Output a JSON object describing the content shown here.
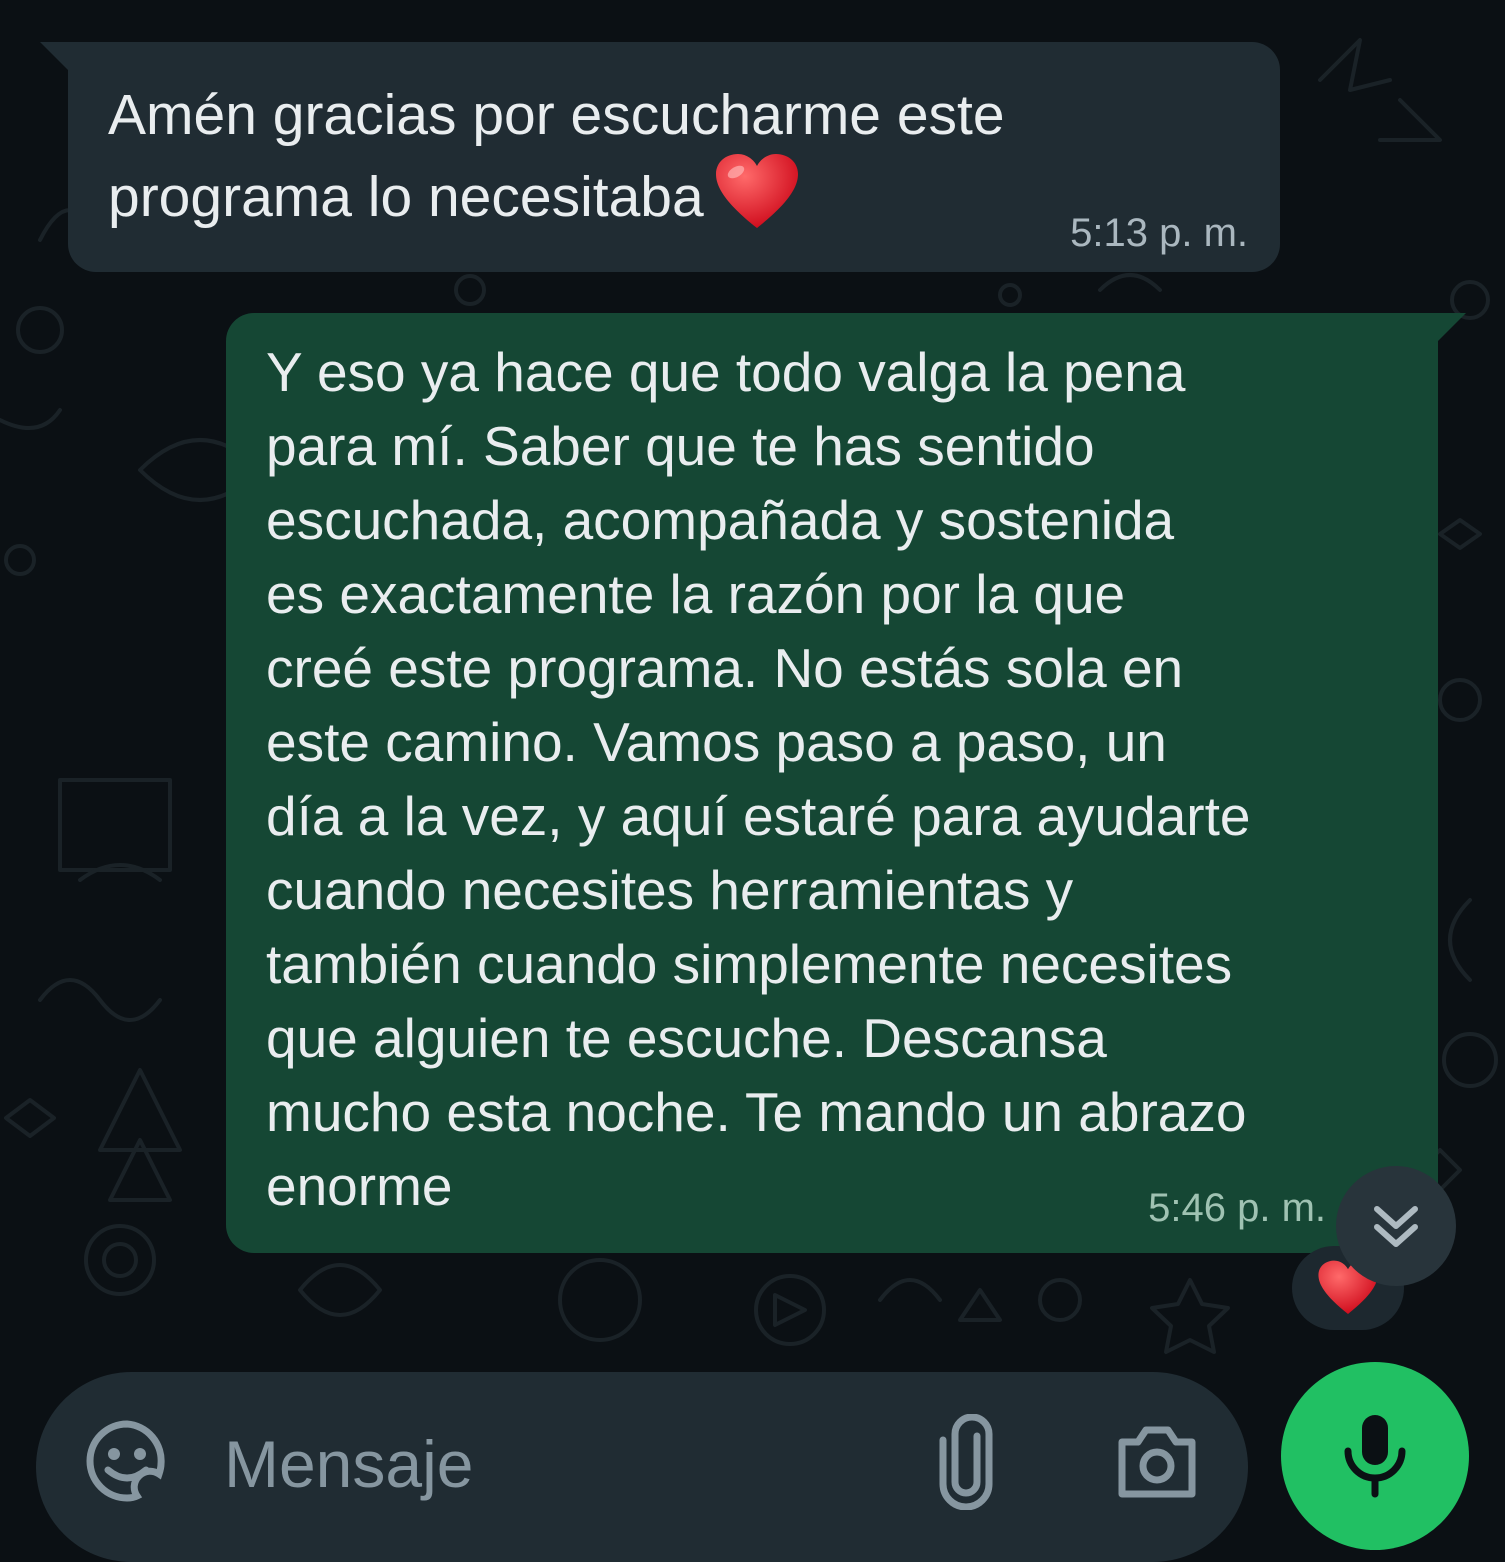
{
  "messages": [
    {
      "direction": "incoming",
      "text": "Amén gracias por escucharme este\nprograma lo necesitaba",
      "emoji": "red-heart",
      "time": "5:13 p. m."
    },
    {
      "direction": "outgoing",
      "text": "Y eso ya hace que todo valga la pena\npara mí. Saber que te has sentido\nescuchada, acompañada y sostenida\nes exactamente la razón por la que\ncreé este programa. No estás sola en\neste camino. Vamos paso a paso, un\ndía a la vez, y aquí estaré para ayudarte\ncuando necesites herramientas y\ntambién cuando simplemente necesites\nque alguien te escuche. Descansa\nmucho esta noche. Te mando un abrazo\nenorme",
      "time": "5:46 p. m.",
      "reaction": "red-heart"
    }
  ],
  "composer": {
    "placeholder": "Mensaje",
    "icons": [
      "sticker-icon",
      "paperclip-icon",
      "camera-icon",
      "microphone-icon"
    ]
  },
  "scroll_button_icon": "double-chevron-down-icon",
  "colors": {
    "background": "#0b1014",
    "incoming_bubble": "#202c33",
    "outgoing_bubble": "#154734",
    "mic_button": "#21c063",
    "text": "#e9edef"
  }
}
